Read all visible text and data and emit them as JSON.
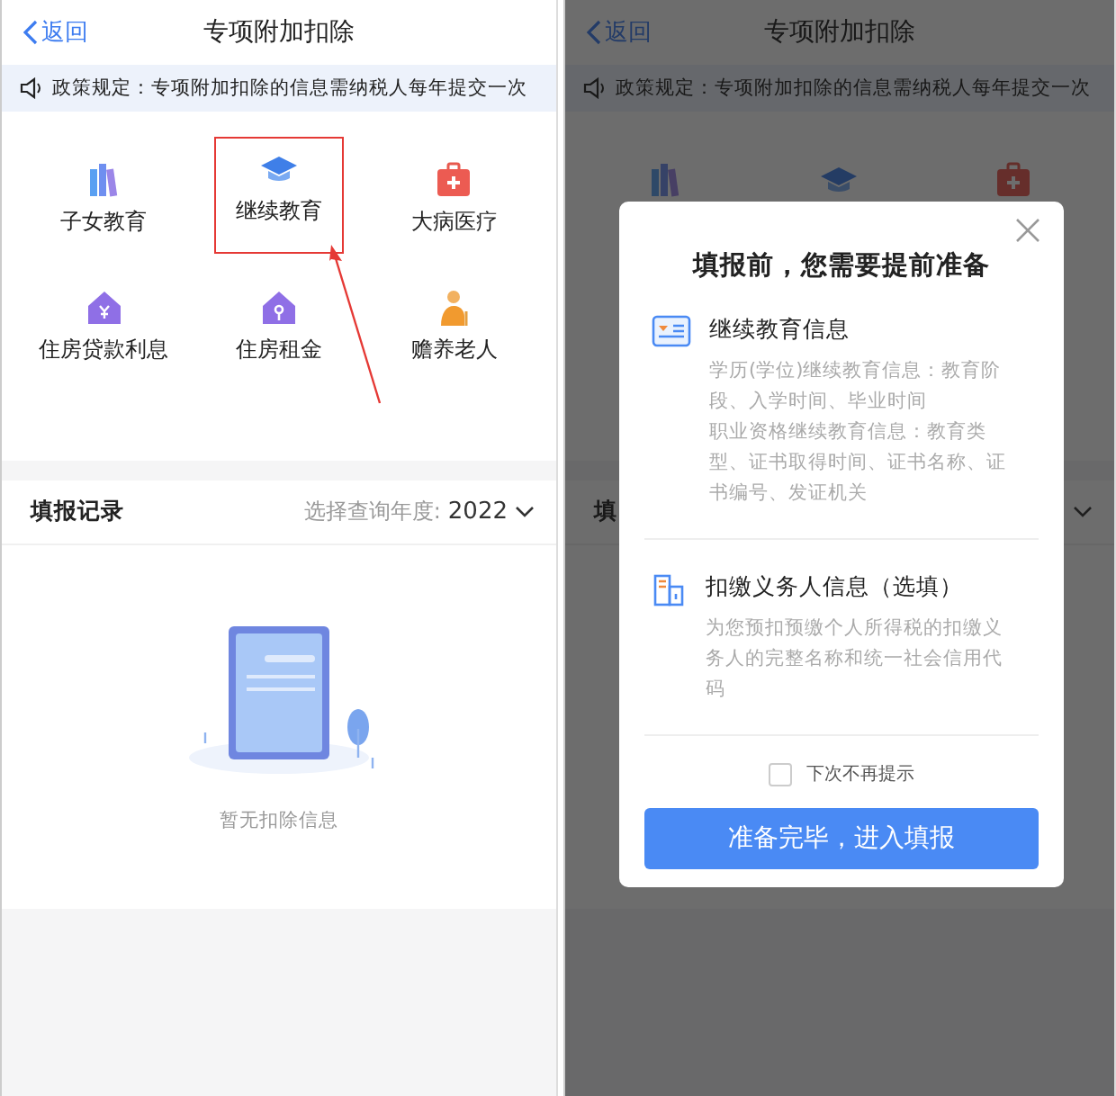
{
  "left_screen": {
    "back": "返回",
    "title": "专项附加扣除",
    "notice": "政策规定：专项附加扣除的信息需纳税人每年提交一次",
    "categories": [
      {
        "kind": "books",
        "label": "子女教育",
        "highlighted": false
      },
      {
        "kind": "cap",
        "label": "继续教育",
        "highlighted": true
      },
      {
        "kind": "medkit",
        "label": "大病医疗",
        "highlighted": false
      },
      {
        "kind": "house-yen",
        "label": "住房贷款利息",
        "highlighted": false
      },
      {
        "kind": "house-key",
        "label": "住房租金",
        "highlighted": false
      },
      {
        "kind": "elder",
        "label": "赡养老人",
        "highlighted": false
      }
    ],
    "records": {
      "title": "填报记录",
      "year_label": "选择查询年度:",
      "year": "2022"
    },
    "empty_text": "暂无扣除信息"
  },
  "right_screen": {
    "back": "返回",
    "title": "专项附加扣除",
    "notice": "政策规定：专项附加扣除的信息需纳税人每年提交一次",
    "categories": [
      {
        "kind": "books"
      },
      {
        "kind": "cap"
      },
      {
        "kind": "medkit"
      }
    ],
    "records": {
      "title": "填"
    },
    "dialog": {
      "title": "填报前，您需要提前准备",
      "sections": [
        {
          "kind": "id-card",
          "title": "继续教育信息",
          "paragraphs": [
            "学历(学位)继续教育信息：教育阶段、入学时间、毕业时间",
            "职业资格继续教育信息：教育类型、证书取得时间、证书名称、证书编号、发证机关"
          ]
        },
        {
          "kind": "building",
          "title": "扣缴义务人信息（选填）",
          "paragraphs": [
            "为您预扣预缴个人所得税的扣缴义务人的完整名称和统一社会信用代码"
          ]
        }
      ],
      "dont_remind": {
        "label": "下次不再提示",
        "checked": false
      },
      "confirm": "准备完毕，进入填报"
    }
  }
}
